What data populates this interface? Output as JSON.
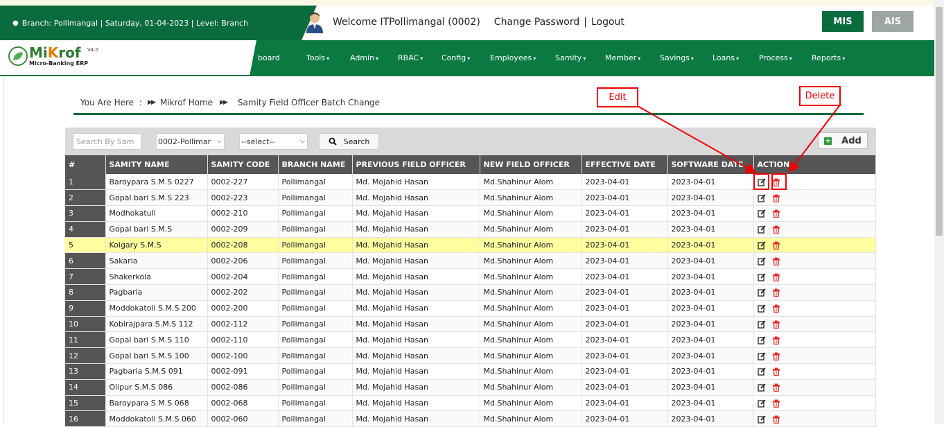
{
  "header": {
    "branch_info": "Branch: Pollimangal | Saturday, 01-04-2023 | Level: Branch",
    "welcome": "Welcome ITPollimangal (0002)",
    "change_password": "Change Password",
    "separator": "|",
    "logout": "Logout",
    "mis": "MIS",
    "ais": "AIS"
  },
  "logo": {
    "brand_pre": "Mi",
    "brand_k": "K",
    "brand_post": "rof",
    "version": "V4.0",
    "tagline": "Micro-Banking ERP"
  },
  "nav": {
    "items": [
      {
        "label": "board"
      },
      {
        "label": "Tools"
      },
      {
        "label": "Admin"
      },
      {
        "label": "RBAC"
      },
      {
        "label": "Config"
      },
      {
        "label": "Employees"
      },
      {
        "label": "Samity"
      },
      {
        "label": "Member"
      },
      {
        "label": "Savings"
      },
      {
        "label": "Loans"
      },
      {
        "label": "Process"
      },
      {
        "label": "Reports"
      }
    ]
  },
  "breadcrumb": {
    "label": "You Are Here",
    "colon": ":",
    "home": "Mikrof Home",
    "current": "Samity Field Officer Batch Change"
  },
  "annotations": {
    "edit": "Edit",
    "delete": "Delete"
  },
  "filters": {
    "search_placeholder": "Search By Sam",
    "branch_value": "0002-Pollimar",
    "select_value": "--select--",
    "search_button": "Search",
    "add_button": "Add"
  },
  "table": {
    "columns": [
      "#",
      "SAMITY NAME",
      "SAMITY CODE",
      "BRANCH NAME",
      "PREVIOUS FIELD OFFICER",
      "NEW FIELD OFFICER",
      "EFFECTIVE DATE",
      "SOFTWARE DATE",
      "ACTION"
    ],
    "rows": [
      {
        "n": "1",
        "name": "Baroypara S.M.S 0227",
        "code": "0002-227",
        "branch": "Pollimangal",
        "prev": "Md. Mojahid Hasan",
        "new": "Md.Shahinur Alom",
        "eff": "2023-04-01",
        "soft": "2023-04-01"
      },
      {
        "n": "2",
        "name": "Gopal bari S.M.S 223",
        "code": "0002-223",
        "branch": "Pollimangal",
        "prev": "Md. Mojahid Hasan",
        "new": "Md.Shahinur Alom",
        "eff": "2023-04-01",
        "soft": "2023-04-01"
      },
      {
        "n": "3",
        "name": "Modhokatuli",
        "code": "0002-210",
        "branch": "Pollimangal",
        "prev": "Md. Mojahid Hasan",
        "new": "Md.Shahinur Alom",
        "eff": "2023-04-01",
        "soft": "2023-04-01"
      },
      {
        "n": "4",
        "name": "Gopal bari S.M.S",
        "code": "0002-209",
        "branch": "Pollimangal",
        "prev": "Md. Mojahid Hasan",
        "new": "Md.Shahinur Alom",
        "eff": "2023-04-01",
        "soft": "2023-04-01"
      },
      {
        "n": "5",
        "name": "Koigary S.M.S",
        "code": "0002-208",
        "branch": "Pollimangal",
        "prev": "Md. Mojahid Hasan",
        "new": "Md.Shahinur Alom",
        "eff": "2023-04-01",
        "soft": "2023-04-01",
        "highlight": true
      },
      {
        "n": "6",
        "name": "Sakaria",
        "code": "0002-206",
        "branch": "Pollimangal",
        "prev": "Md. Mojahid Hasan",
        "new": "Md.Shahinur Alom",
        "eff": "2023-04-01",
        "soft": "2023-04-01"
      },
      {
        "n": "7",
        "name": "Shakerkola",
        "code": "0002-204",
        "branch": "Pollimangal",
        "prev": "Md. Mojahid Hasan",
        "new": "Md.Shahinur Alom",
        "eff": "2023-04-01",
        "soft": "2023-04-01"
      },
      {
        "n": "8",
        "name": "Pagbaria",
        "code": "0002-202",
        "branch": "Pollimangal",
        "prev": "Md. Mojahid Hasan",
        "new": "Md.Shahinur Alom",
        "eff": "2023-04-01",
        "soft": "2023-04-01"
      },
      {
        "n": "9",
        "name": "Moddokatoli S.M.S 200",
        "code": "0002-200",
        "branch": "Pollimangal",
        "prev": "Md. Mojahid Hasan",
        "new": "Md.Shahinur Alom",
        "eff": "2023-04-01",
        "soft": "2023-04-01"
      },
      {
        "n": "10",
        "name": "Kobirajpara S.M.S 112",
        "code": "0002-112",
        "branch": "Pollimangal",
        "prev": "Md. Mojahid Hasan",
        "new": "Md.Shahinur Alom",
        "eff": "2023-04-01",
        "soft": "2023-04-01"
      },
      {
        "n": "11",
        "name": "Gopal bari S.M.S 110",
        "code": "0002-110",
        "branch": "Pollimangal",
        "prev": "Md. Mojahid Hasan",
        "new": "Md.Shahinur Alom",
        "eff": "2023-04-01",
        "soft": "2023-04-01"
      },
      {
        "n": "12",
        "name": "Gopal bari S.M.S 100",
        "code": "0002-100",
        "branch": "Pollimangal",
        "prev": "Md. Mojahid Hasan",
        "new": "Md.Shahinur Alom",
        "eff": "2023-04-01",
        "soft": "2023-04-01"
      },
      {
        "n": "13",
        "name": "Pagbaria S.M.S 091",
        "code": "0002-091",
        "branch": "Pollimangal",
        "prev": "Md. Mojahid Hasan",
        "new": "Md.Shahinur Alom",
        "eff": "2023-04-01",
        "soft": "2023-04-01"
      },
      {
        "n": "14",
        "name": "Olipur S.M.S 086",
        "code": "0002-086",
        "branch": "Pollimangal",
        "prev": "Md. Mojahid Hasan",
        "new": "Md.Shahinur Alom",
        "eff": "2023-04-01",
        "soft": "2023-04-01"
      },
      {
        "n": "15",
        "name": "Baroypara S.M.S 068",
        "code": "0002-068",
        "branch": "Pollimangal",
        "prev": "Md. Mojahid Hasan",
        "new": "Md.Shahinur Alom",
        "eff": "2023-04-01",
        "soft": "2023-04-01"
      },
      {
        "n": "16",
        "name": "Moddokatoli S.M.S 060",
        "code": "0002-060",
        "branch": "Pollimangal",
        "prev": "Md. Mojahid Hasan",
        "new": "Md.Shahinur Alom",
        "eff": "2023-04-01",
        "soft": "2023-04-01"
      }
    ]
  },
  "colors": {
    "brand_green": "#0a6b3d",
    "nav_green": "#0a7a42",
    "header_gray": "#555555",
    "highlight": "#ffffa0",
    "annotation_red": "#ee0000"
  },
  "icons": {
    "edit": "edit-icon",
    "delete": "trash-icon",
    "search": "search-icon",
    "add": "plus-icon",
    "globe": "globe-icon",
    "avatar": "user-avatar-icon"
  }
}
